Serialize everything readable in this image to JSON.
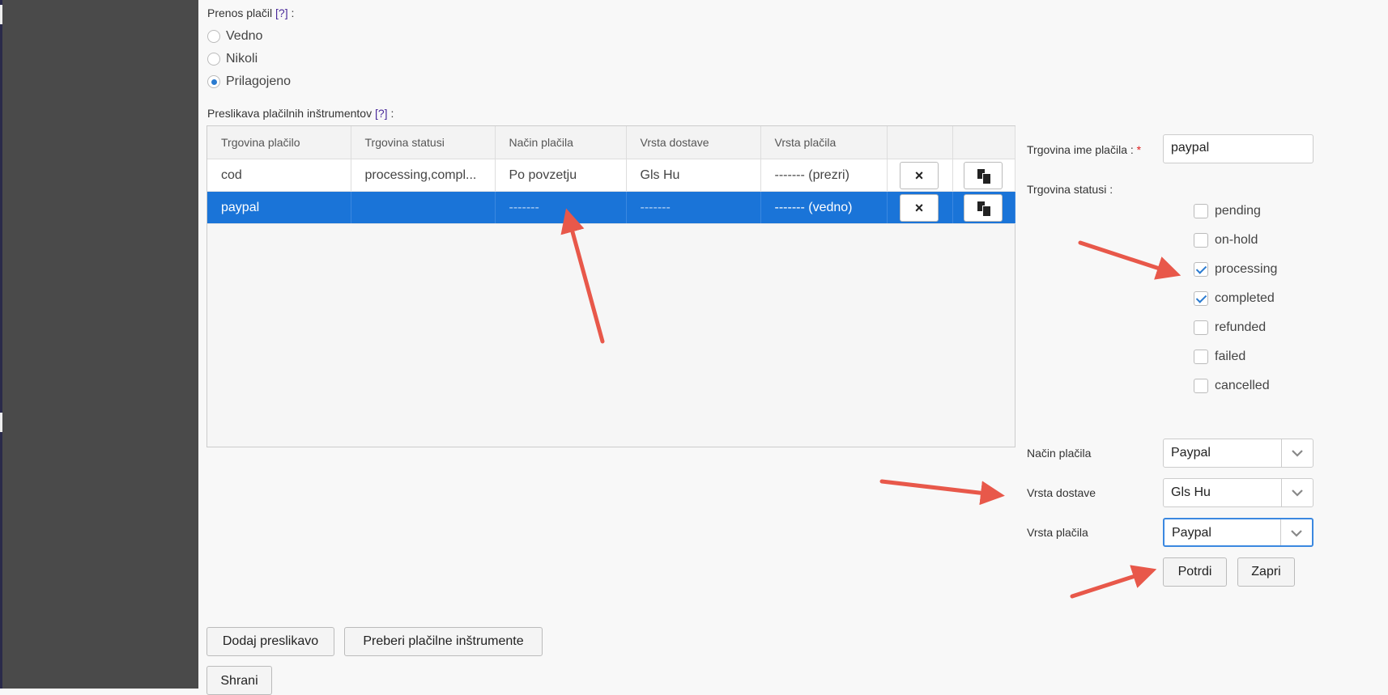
{
  "payment_transfer": {
    "label": "Prenos plačil",
    "help": "[?]",
    "colon": ":",
    "options": [
      {
        "label": "Vedno",
        "selected": false
      },
      {
        "label": "Nikoli",
        "selected": false
      },
      {
        "label": "Prilagojeno",
        "selected": true
      }
    ]
  },
  "mapping": {
    "label": "Preslikava plačilnih inštrumentov",
    "help": "[?]",
    "colon": ":",
    "columns": [
      "Trgovina plačilo",
      "Trgovina statusi",
      "Način plačila",
      "Vrsta dostave",
      "Vrsta plačila",
      "",
      ""
    ],
    "rows": [
      {
        "shop_payment": "cod",
        "shop_statuses": "processing,compl...",
        "payment_method": "Po povzetju",
        "delivery_type": "Gls Hu",
        "payment_type": "------- (prezri)",
        "selected": false
      },
      {
        "shop_payment": "paypal",
        "shop_statuses": "",
        "payment_method": "-------",
        "delivery_type": "-------",
        "payment_type": "------- (vedno)",
        "selected": true
      }
    ],
    "delete_symbol": "×"
  },
  "editor": {
    "name_label": "Trgovina ime plačila :",
    "required_mark": "*",
    "name_value": "paypal",
    "statuses_label": "Trgovina statusi :",
    "statuses": [
      {
        "label": "pending",
        "checked": false
      },
      {
        "label": "on-hold",
        "checked": false
      },
      {
        "label": "processing",
        "checked": true
      },
      {
        "label": "completed",
        "checked": true
      },
      {
        "label": "refunded",
        "checked": false
      },
      {
        "label": "failed",
        "checked": false
      },
      {
        "label": "cancelled",
        "checked": false
      }
    ],
    "payment_method_label": "Način plačila",
    "payment_method_value": "Paypal",
    "delivery_type_label": "Vrsta dostave",
    "delivery_type_value": "Gls Hu",
    "payment_type_label": "Vrsta plačila",
    "payment_type_value": "Paypal",
    "confirm_label": "Potrdi",
    "close_label": "Zapri"
  },
  "footer": {
    "add_mapping_label": "Dodaj preslikavo",
    "read_instruments_label": "Preberi plačilne inštrumente",
    "save_label": "Shrani"
  },
  "colors": {
    "selected_row": "#1a74d8",
    "annotation_arrow": "#e8584a",
    "accent": "#2b7bd0"
  }
}
